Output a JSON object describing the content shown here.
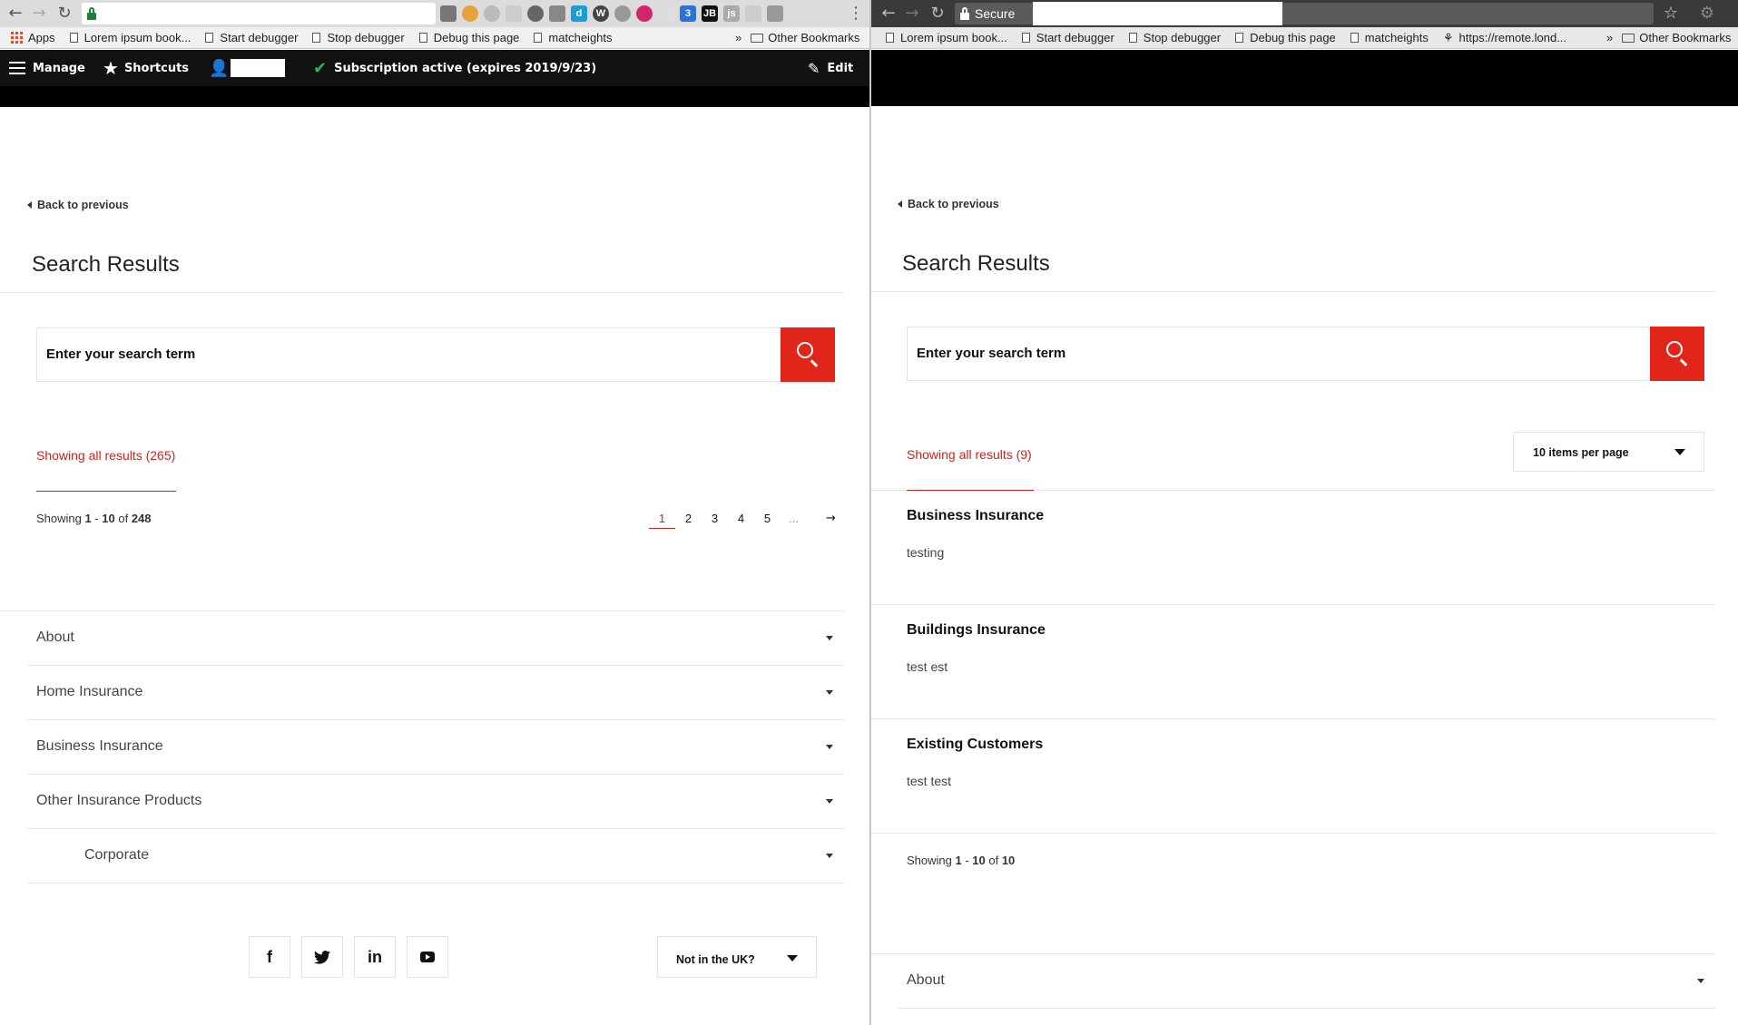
{
  "left": {
    "bookmarks": [
      "Apps",
      "Lorem ipsum book...",
      "Start debugger",
      "Stop debugger",
      "Debug this page",
      "matcheights",
      "Other Bookmarks"
    ],
    "toolbar": {
      "manage": "Manage",
      "shortcuts": "Shortcuts",
      "subscription": "Subscription active (expires 2019/9/23)",
      "edit": "Edit"
    },
    "back": "Back to previous",
    "title": "Search Results",
    "search_placeholder": "Enter your search term",
    "showing_all": "Showing all results (265)",
    "count": {
      "prefix": "Showing ",
      "from": "1",
      "sep": " - ",
      "to": "10",
      "of": " of ",
      "total": "248"
    },
    "pager": [
      "1",
      "2",
      "3",
      "4",
      "5",
      "...",
      "→"
    ],
    "accordion": [
      "About",
      "Home Insurance",
      "Business Insurance",
      "Other Insurance Products",
      "Corporate"
    ],
    "country": "Not in the UK?"
  },
  "right": {
    "secure": "Secure",
    "bookmarks": [
      "Lorem ipsum book...",
      "Start debugger",
      "Stop debugger",
      "Debug this page",
      "matcheights",
      "https://remote.lond...",
      "Other Bookmarks"
    ],
    "back": "Back to previous",
    "title": "Search Results",
    "search_placeholder": "Enter your search term",
    "showing_all": "Showing all results (9)",
    "per_page": "10 items per page",
    "results": [
      {
        "title": "Business Insurance",
        "desc": "testing"
      },
      {
        "title": "Buildings Insurance",
        "desc": "test est"
      },
      {
        "title": "Existing Customers",
        "desc": "test test"
      }
    ],
    "count": {
      "prefix": "Showing ",
      "from": "1",
      "sep": " - ",
      "to": "10",
      "of": " of ",
      "total": "10"
    },
    "accordion": [
      "About"
    ]
  }
}
